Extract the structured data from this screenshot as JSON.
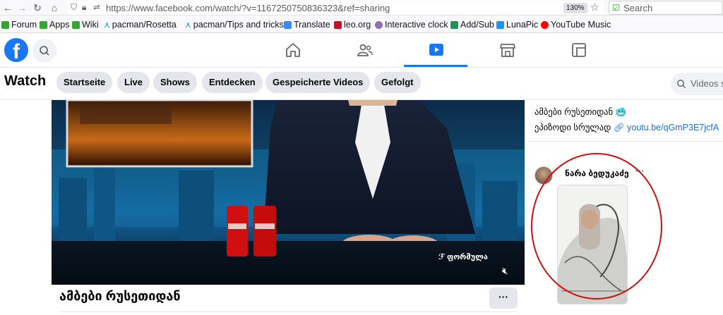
{
  "browser": {
    "url": "https://www.facebook.com/watch/?v=1167250750836323&ref=sharing",
    "zoom": "130%",
    "search_placeholder": "Search",
    "bookmarks": [
      {
        "label": "Forum",
        "color": "#3aa335"
      },
      {
        "label": "Apps",
        "color": "#3aa335"
      },
      {
        "label": "Wiki",
        "color": "#3aa335"
      },
      {
        "label": "pacman/Rosetta",
        "color": "#1793d1"
      },
      {
        "label": "pacman/Tips and tricks",
        "color": "#1793d1"
      },
      {
        "label": "Translate",
        "color": "#4285f4"
      },
      {
        "label": "leo.org",
        "color": "#c8102e"
      },
      {
        "label": "Interactive clock",
        "color": "#8e6fb5"
      },
      {
        "label": "Add/Sub",
        "color": "#2e8b57"
      },
      {
        "label": "LunaPic",
        "color": "#1e90ff"
      },
      {
        "label": "YouTube Music",
        "color": "#ff0000"
      }
    ]
  },
  "facebook": {
    "logo_letter": "f",
    "accent_color": "#1877f2",
    "nav_icons": [
      "home-icon",
      "friends-icon",
      "watch-icon",
      "marketplace-icon",
      "gaming-icon"
    ],
    "active_nav": "watch-icon"
  },
  "watch": {
    "title": "Watch",
    "chips": [
      "Startseite",
      "Live",
      "Shows",
      "Entdecken",
      "Gespeicherte Videos",
      "Gefolgt"
    ],
    "search_placeholder": "Videos s"
  },
  "video": {
    "watermark": "ფორმულა",
    "title": "ამბები რუსეთიდან",
    "more_label": "···",
    "muted_icon": "mute-icon"
  },
  "right_column": {
    "line1": "ამბები რუსეთიდან",
    "line1_emoji": "🥶",
    "line2_prefix": "ეპიზოდი სრულად",
    "line2_link": "youtu.be/qGmP3E7jcfA",
    "commenter_name": "ნარა ბედუკაძე",
    "comment_more": "···",
    "annotation_color": "#cc1111"
  }
}
